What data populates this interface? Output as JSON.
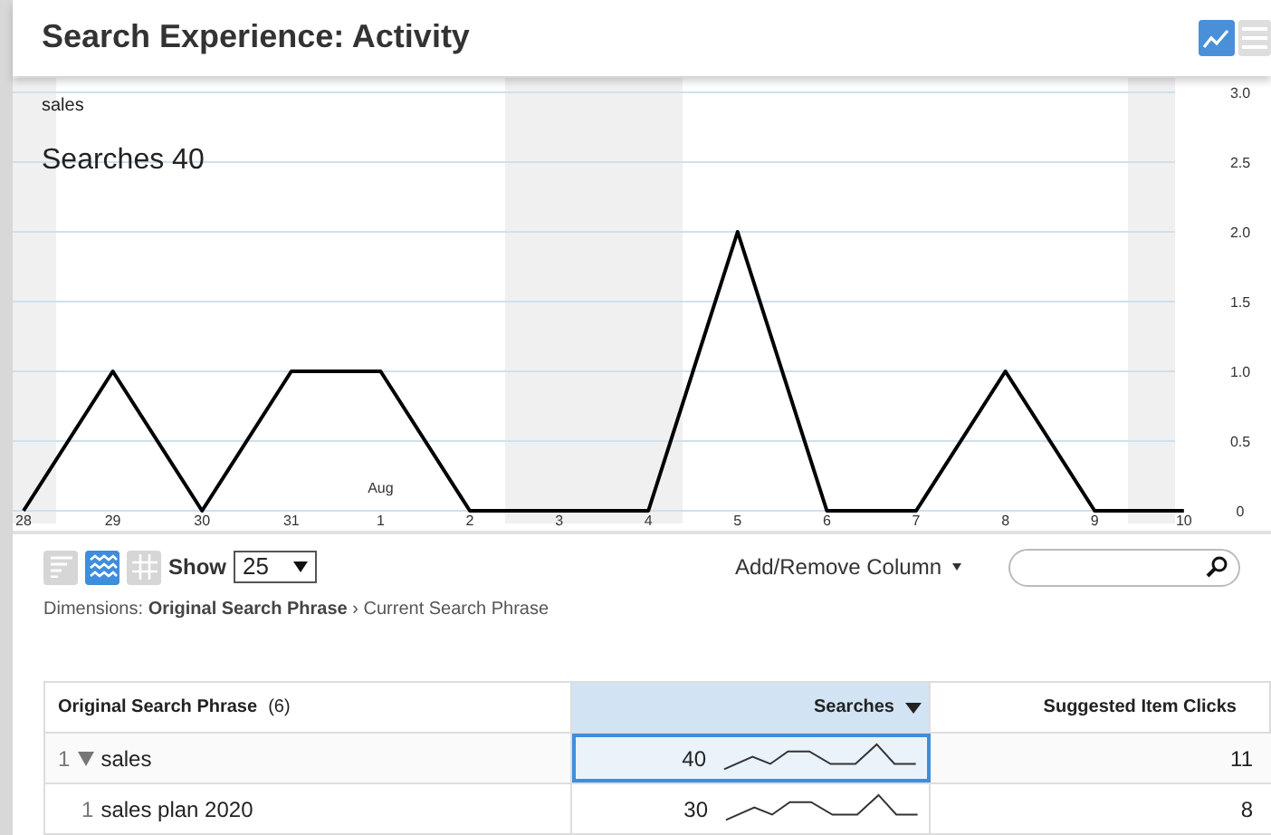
{
  "header": {
    "title": "Search Experience: Activity"
  },
  "chart": {
    "series_label": "sales",
    "headline_value": "40",
    "chart_data": {
      "type": "line",
      "grid": true,
      "categories": [
        "28",
        "29",
        "30",
        "31",
        "1",
        "2",
        "3",
        "4",
        "5",
        "6",
        "7",
        "8",
        "9",
        "10"
      ],
      "series": [
        {
          "name": "Searches",
          "color": "#000000",
          "values": [
            0,
            1,
            0,
            1,
            1,
            0,
            0,
            0,
            2,
            0,
            0,
            1,
            0,
            0
          ]
        }
      ],
      "ylim": [
        0,
        3
      ],
      "yticks": [
        {
          "value": 0,
          "label": "0"
        },
        {
          "value": 0.5,
          "label": "0.5"
        },
        {
          "value": 1,
          "label": "1.0"
        },
        {
          "value": 1.5,
          "label": "1.5"
        },
        {
          "value": 2,
          "label": "2.0"
        },
        {
          "value": 2.5,
          "label": "2.5"
        },
        {
          "value": 3,
          "label": "3.0"
        }
      ],
      "annotations": [
        "Aug"
      ]
    }
  },
  "toolbar": {
    "view_buttons": [
      {
        "kind": "bars",
        "selected": false
      },
      {
        "kind": "wave",
        "selected": true
      },
      {
        "kind": "grid",
        "selected": false
      }
    ],
    "show_label": "Show",
    "show_value": "25",
    "add_remove": "Add/Remove Column",
    "dimensions": "Dimensions: **Original Search Phrase** › Current Search Phrase"
  },
  "table": {
    "columns": [
      {
        "label": "Original Search Phrase",
        "count": "(6)",
        "sorted": false
      },
      {
        "label": "Searches",
        "sorted": true
      },
      {
        "label": "Suggested Item Clicks",
        "sorted": false
      }
    ],
    "rows": [
      {
        "rank": "1",
        "phrase": "sales",
        "expanded": true,
        "selected": true,
        "searches": "40",
        "clicks": "11",
        "children": [
          {
            "rank": "1",
            "phrase": "sales plan 2020",
            "selected": false,
            "searches": "30",
            "clicks": "8"
          }
        ]
      }
    ]
  }
}
